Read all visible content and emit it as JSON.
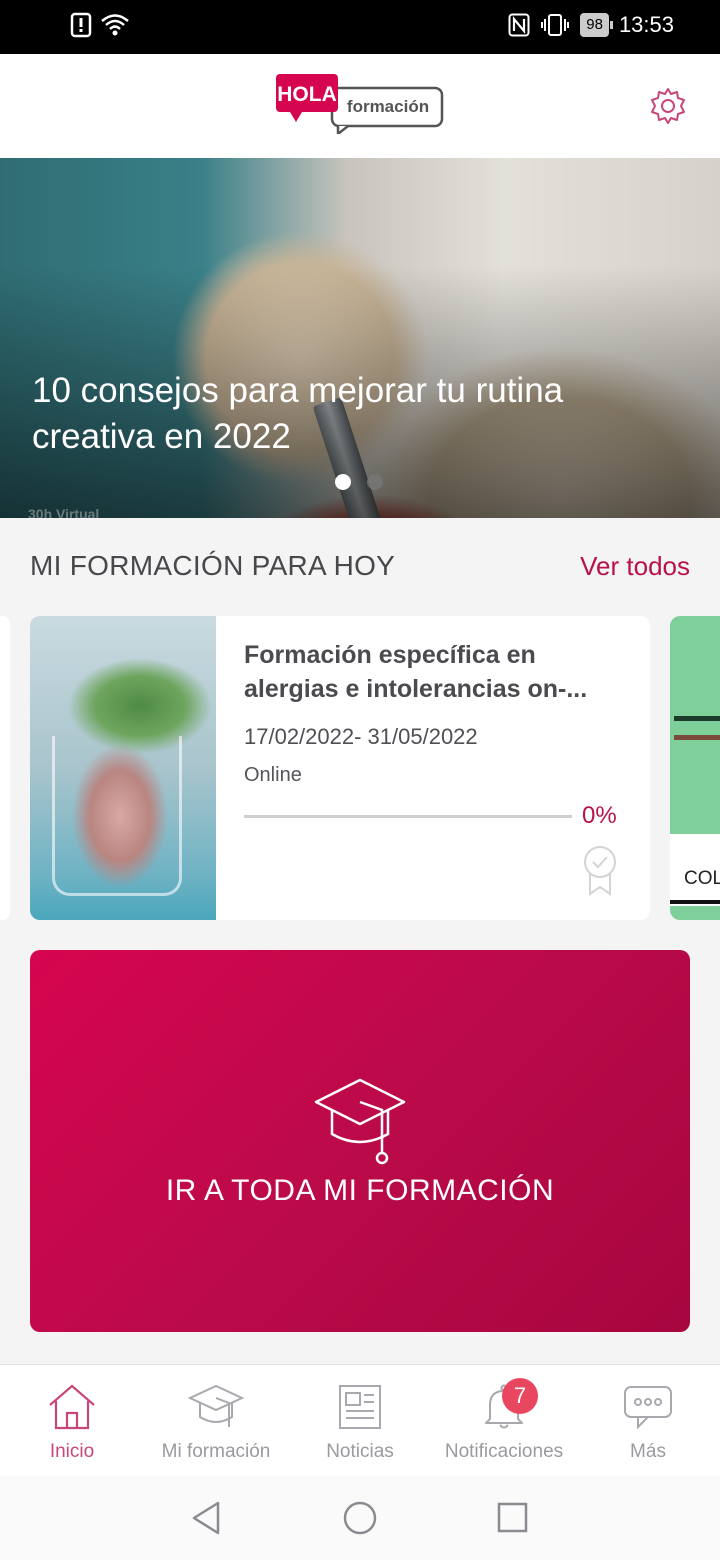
{
  "status_bar": {
    "nfc_icon": "nfc-icon",
    "battery_level": "98",
    "time": "13:53"
  },
  "app": {
    "logo_text_main": "HOLA",
    "logo_text_sub": "formación",
    "settings_icon": "gear-icon",
    "brand_color": "#b8114b"
  },
  "hero": {
    "title": "10 consejos para mejorar tu rutina creativa en 2022",
    "caption": "30h Virtual",
    "slides_total": 2,
    "active_slide": 1
  },
  "section": {
    "title": "MI FORMACIÓN PARA HOY",
    "see_all": "Ver todos"
  },
  "courses": [
    {
      "title": "Formación específica en alergias e intolerancias on-...",
      "dates": "17/02/2022- 31/05/2022",
      "mode": "Online",
      "progress_label": "0%",
      "progress": 0
    },
    {
      "label": "COL"
    }
  ],
  "cta": {
    "label": "IR A TODA MI FORMACIÓN",
    "icon": "graduation-cap-icon"
  },
  "bottom_nav": {
    "items": [
      {
        "label": "Inicio",
        "icon": "home-icon",
        "active": true
      },
      {
        "label": "Mi formación",
        "icon": "graduation-cap-icon",
        "active": false
      },
      {
        "label": "Noticias",
        "icon": "newspaper-icon",
        "active": false
      },
      {
        "label": "Notificaciones",
        "icon": "bell-icon",
        "active": false
      },
      {
        "label": "Más",
        "icon": "chat-bubble-icon",
        "active": false
      }
    ],
    "notifications_badge": "7"
  }
}
